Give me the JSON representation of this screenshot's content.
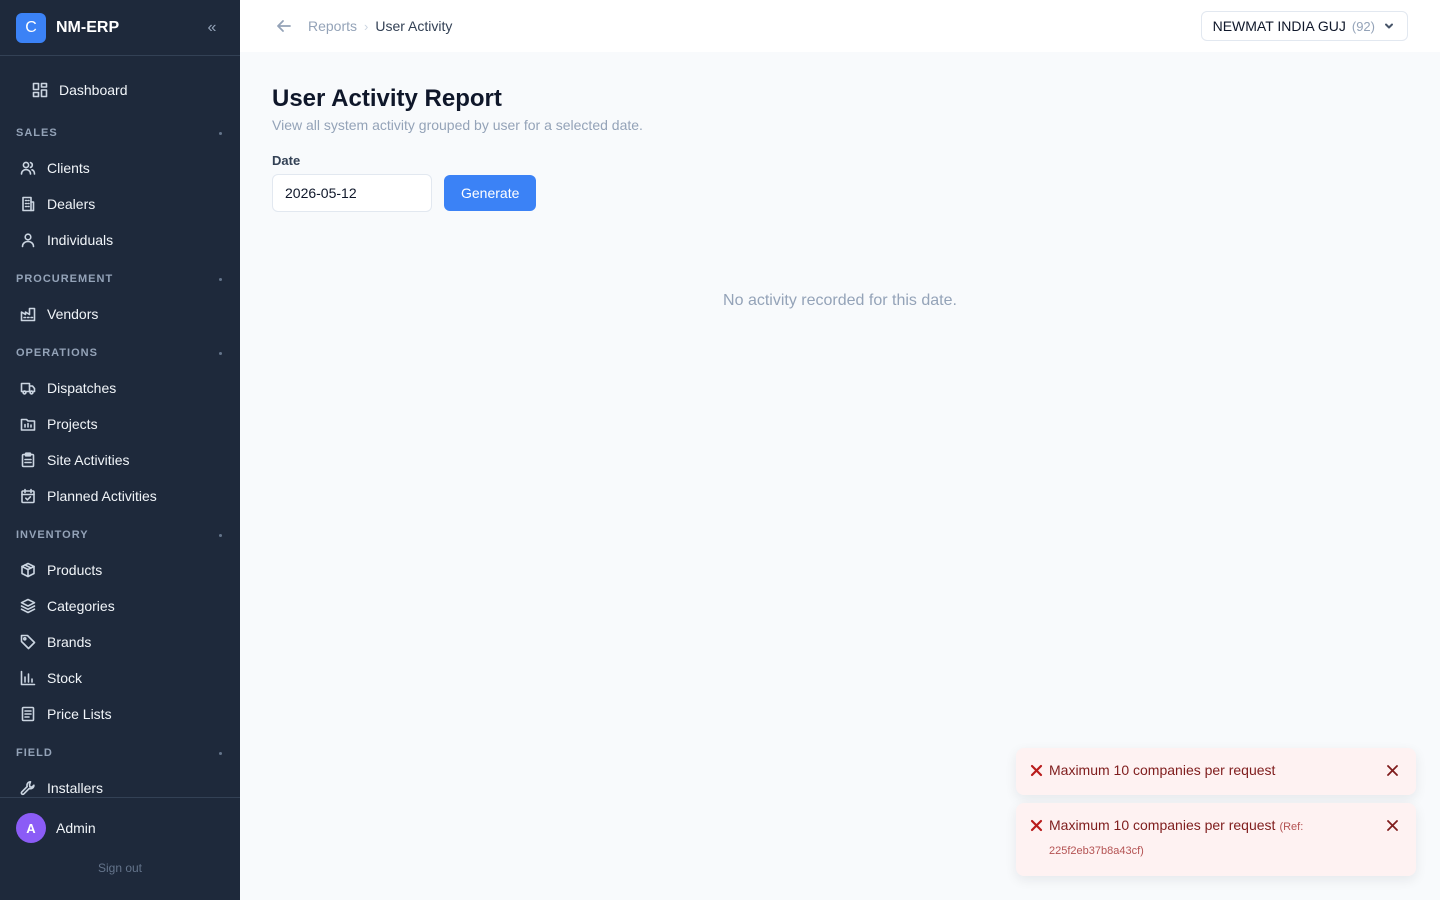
{
  "app": {
    "logo_letter": "C",
    "name": "NM-ERP"
  },
  "sidebar": {
    "dashboard": {
      "label": "Dashboard",
      "icon": "dashboard-icon"
    },
    "sections": [
      {
        "title": "SALES",
        "items": [
          {
            "label": "Clients",
            "icon": "users-icon"
          },
          {
            "label": "Dealers",
            "icon": "building-icon"
          },
          {
            "label": "Individuals",
            "icon": "user-icon"
          }
        ]
      },
      {
        "title": "PROCUREMENT",
        "items": [
          {
            "label": "Vendors",
            "icon": "factory-icon"
          }
        ]
      },
      {
        "title": "OPERATIONS",
        "items": [
          {
            "label": "Dispatches",
            "icon": "truck-icon"
          },
          {
            "label": "Projects",
            "icon": "folder-icon"
          },
          {
            "label": "Site Activities",
            "icon": "clipboard-icon"
          },
          {
            "label": "Planned Activities",
            "icon": "calendar-check-icon"
          }
        ]
      },
      {
        "title": "INVENTORY",
        "items": [
          {
            "label": "Products",
            "icon": "package-icon"
          },
          {
            "label": "Categories",
            "icon": "layers-icon"
          },
          {
            "label": "Brands",
            "icon": "tag-icon"
          },
          {
            "label": "Stock",
            "icon": "bar-chart-icon"
          },
          {
            "label": "Price Lists",
            "icon": "document-icon"
          }
        ]
      },
      {
        "title": "FIELD",
        "items": [
          {
            "label": "Installers",
            "icon": "wrench-icon"
          }
        ]
      }
    ],
    "user": {
      "initial": "A",
      "name": "Admin",
      "signout": "Sign out"
    }
  },
  "topbar": {
    "breadcrumb": {
      "parent": "Reports",
      "separator": "›",
      "current": "User Activity"
    },
    "company": {
      "name": "NEWMAT INDIA GUJ",
      "count": "(92)"
    }
  },
  "main": {
    "title": "User Activity Report",
    "subtitle": "View all system activity grouped by user for a selected date.",
    "date_label": "Date",
    "date_value": "2026-05-12",
    "generate_label": "Generate",
    "empty_text": "No activity recorded for this date."
  },
  "toasts": [
    {
      "message": "Maximum 10 companies per request",
      "ref": ""
    },
    {
      "message": "Maximum 10 companies per request",
      "ref": "(Ref: 225f2eb37b8a43cf)"
    }
  ],
  "colors": {
    "sidebar_bg": "#1e293b",
    "accent": "#3b82f6",
    "toast_bg": "#fef2f2",
    "error": "#b91c1c"
  }
}
